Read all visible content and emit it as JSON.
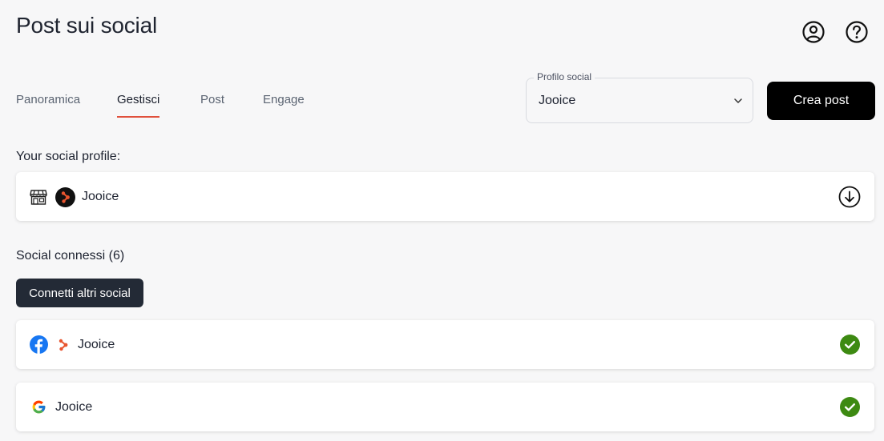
{
  "header": {
    "title": "Post sui social",
    "icons": [
      "account-icon",
      "help-icon"
    ]
  },
  "tabs": [
    {
      "label": "Panoramica",
      "active": false
    },
    {
      "label": "Gestisci",
      "active": true
    },
    {
      "label": "Post",
      "active": false
    },
    {
      "label": "Engage",
      "active": false
    }
  ],
  "profile_select": {
    "label": "Profilo social",
    "value": "Jooice"
  },
  "create_post_label": "Crea post",
  "your_profile": {
    "heading": "Your social profile:",
    "name": "Jooice",
    "icons": [
      "store-icon",
      "jooice-logo-icon",
      "download-icon"
    ]
  },
  "connected": {
    "heading": "Social connessi (6)",
    "connect_button": "Connetti altri social",
    "items": [
      {
        "platform": "facebook",
        "name": "Jooice",
        "status": "connected",
        "icon": "facebook-icon"
      },
      {
        "platform": "google",
        "name": "Jooice",
        "status": "connected",
        "icon": "google-icon"
      }
    ]
  },
  "colors": {
    "accent": "#e0503c",
    "primary_button": "#000000",
    "secondary_button": "#232a36",
    "success": "#3d8a12",
    "facebook": "#1877f2"
  }
}
